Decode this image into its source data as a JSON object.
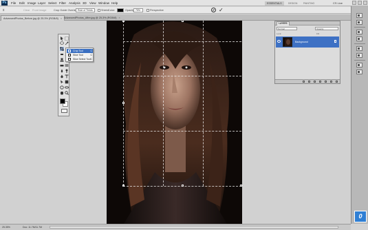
{
  "menubar": {
    "logo": "Ps",
    "items": [
      "File",
      "Edit",
      "Image",
      "Layer",
      "Select",
      "Filter",
      "Analysis",
      "3D",
      "View",
      "Window",
      "Help"
    ],
    "workspaces": [
      "ESSENTIALS",
      "DESIGN",
      "PAINTING"
    ],
    "cs_live": "CS Live"
  },
  "options": {
    "clear_label": "Clear",
    "front_image_label": "Front Image",
    "crop_guide_label": "Crop Guide Overlay:",
    "crop_guide_value": "Rule of Thirds",
    "shield_label": "Shield",
    "color_label": "Color:",
    "opacity_label": "Opacity:",
    "opacity_value": "75%",
    "perspective_label": "Perspective"
  },
  "tabs": [
    {
      "label": "AdvancedPhotos_Before.jpg @ 25.3% (RGB/8)"
    },
    {
      "label": "AdvancedPhotos_After.jpg @ 25.3% (RGB/8)"
    }
  ],
  "flyout": {
    "items": [
      {
        "label": "Crop Tool",
        "key": "C"
      },
      {
        "label": "Slice Tool",
        "key": "C"
      },
      {
        "label": "Slice Select Tool",
        "key": "C"
      }
    ]
  },
  "layers_panel": {
    "tab_label": "LAYERS",
    "mode": "Normal",
    "opacity_label": "Opacity:",
    "lock_label": "Lock:",
    "fill_label": "Fill:",
    "layer_name": "Background"
  },
  "status": {
    "zoom": "25.35%",
    "doc": "Doc: 11.7M/11.7M"
  },
  "watermark": "0",
  "colors": {
    "selection_blue": "#3e71c4",
    "foreground": "#000000",
    "background": "#ffffff"
  }
}
